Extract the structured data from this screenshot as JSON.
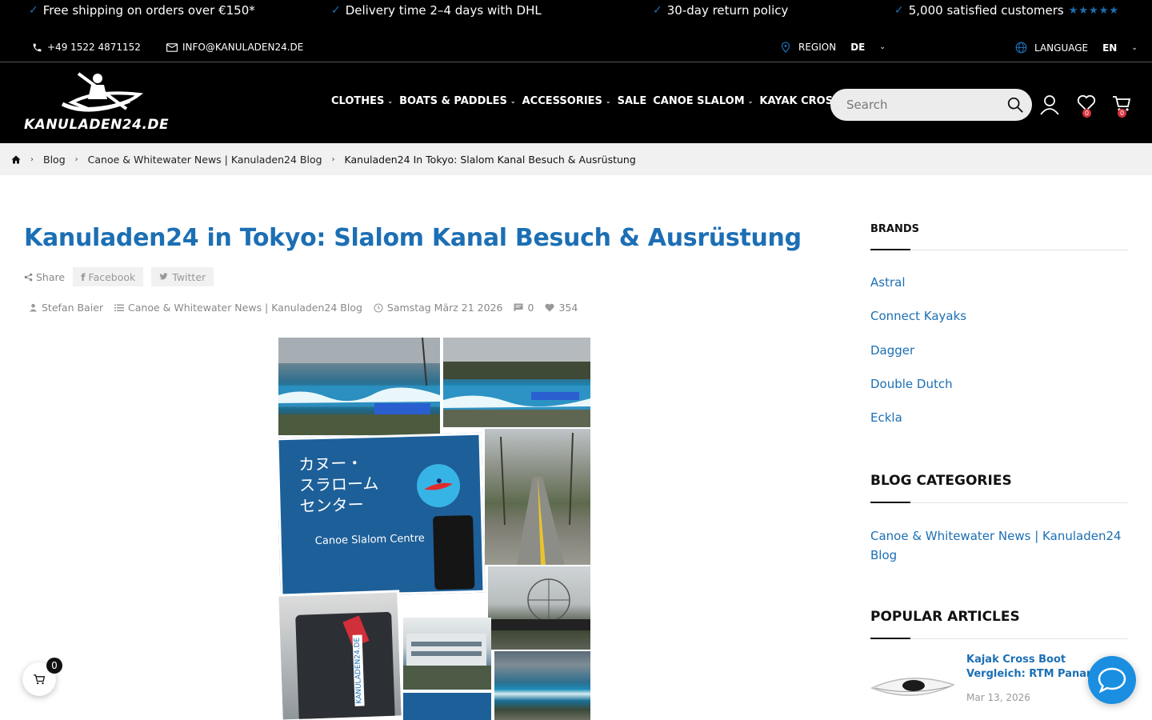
{
  "promo": {
    "items": [
      "Free shipping on orders over €150*",
      "Delivery time 2–4 days with DHL",
      "30-day return policy",
      "5,000 satisfied customers"
    ],
    "check_icon": "check-icon",
    "stars": "★★★★★",
    "phone": "+49 1522 4871152",
    "email": "INFO@KANULADEN24.DE",
    "region_label": "REGION",
    "region_value": "DE",
    "language_label": "LANGUAGE",
    "language_value": "EN"
  },
  "header": {
    "logo_text": "KANULADEN24.DE",
    "nav": [
      {
        "label": "CLOTHES",
        "dropdown": true
      },
      {
        "label": "BOATS & PADDLES",
        "dropdown": true
      },
      {
        "label": "ACCESSORIES",
        "dropdown": true
      },
      {
        "label": "SALE",
        "dropdown": false
      },
      {
        "label": "CANOE SLALOM",
        "dropdown": true
      },
      {
        "label": "KAYAK CROSS",
        "dropdown": true
      }
    ],
    "search_placeholder": "Search",
    "wishlist_count": "0",
    "cart_count": "0"
  },
  "breadcrumb": {
    "items": [
      "Blog",
      "Canoe & Whitewater News | Kanuladen24 Blog"
    ],
    "current": "Kanuladen24 In Tokyo: Slalom Kanal Besuch & Ausrüstung"
  },
  "article": {
    "title": "Kanuladen24 in Tokyo: Slalom Kanal Besuch & Ausrüstung",
    "share_label": "Share",
    "facebook_label": "Facebook",
    "twitter_label": "Twitter",
    "author": "Stefan Baier",
    "category": "Canoe & Whitewater News | Kanuladen24 Blog",
    "date": "Samstag März 21 2026",
    "comments": "0",
    "likes": "354",
    "image_sign_text": "カヌー・\nスラローム\nセンター",
    "image_sign_caption": "Canoe Slalom Centre",
    "image_suitcase_text": "KANULADEN24.DE"
  },
  "sidebar": {
    "brands_heading": "BRANDS",
    "brands": [
      "Astral",
      "Connect Kayaks",
      "Dagger",
      "Double Dutch",
      "Eckla"
    ],
    "categories_heading": "BLOG CATEGORIES",
    "categories": [
      "Canoe & Whitewater News | Kanuladen24 Blog"
    ],
    "popular_heading": "POPULAR ARTICLES",
    "popular": [
      {
        "title": "Kajak Cross Boot Vergleich: RTM Paname",
        "date": "Mar 13, 2026"
      }
    ]
  },
  "floating": {
    "cart_count": "0"
  },
  "colors": {
    "accent": "#1c6fb4",
    "header_bg": "#000000",
    "badge": "#d8323c",
    "chat": "#1a8ee0"
  }
}
